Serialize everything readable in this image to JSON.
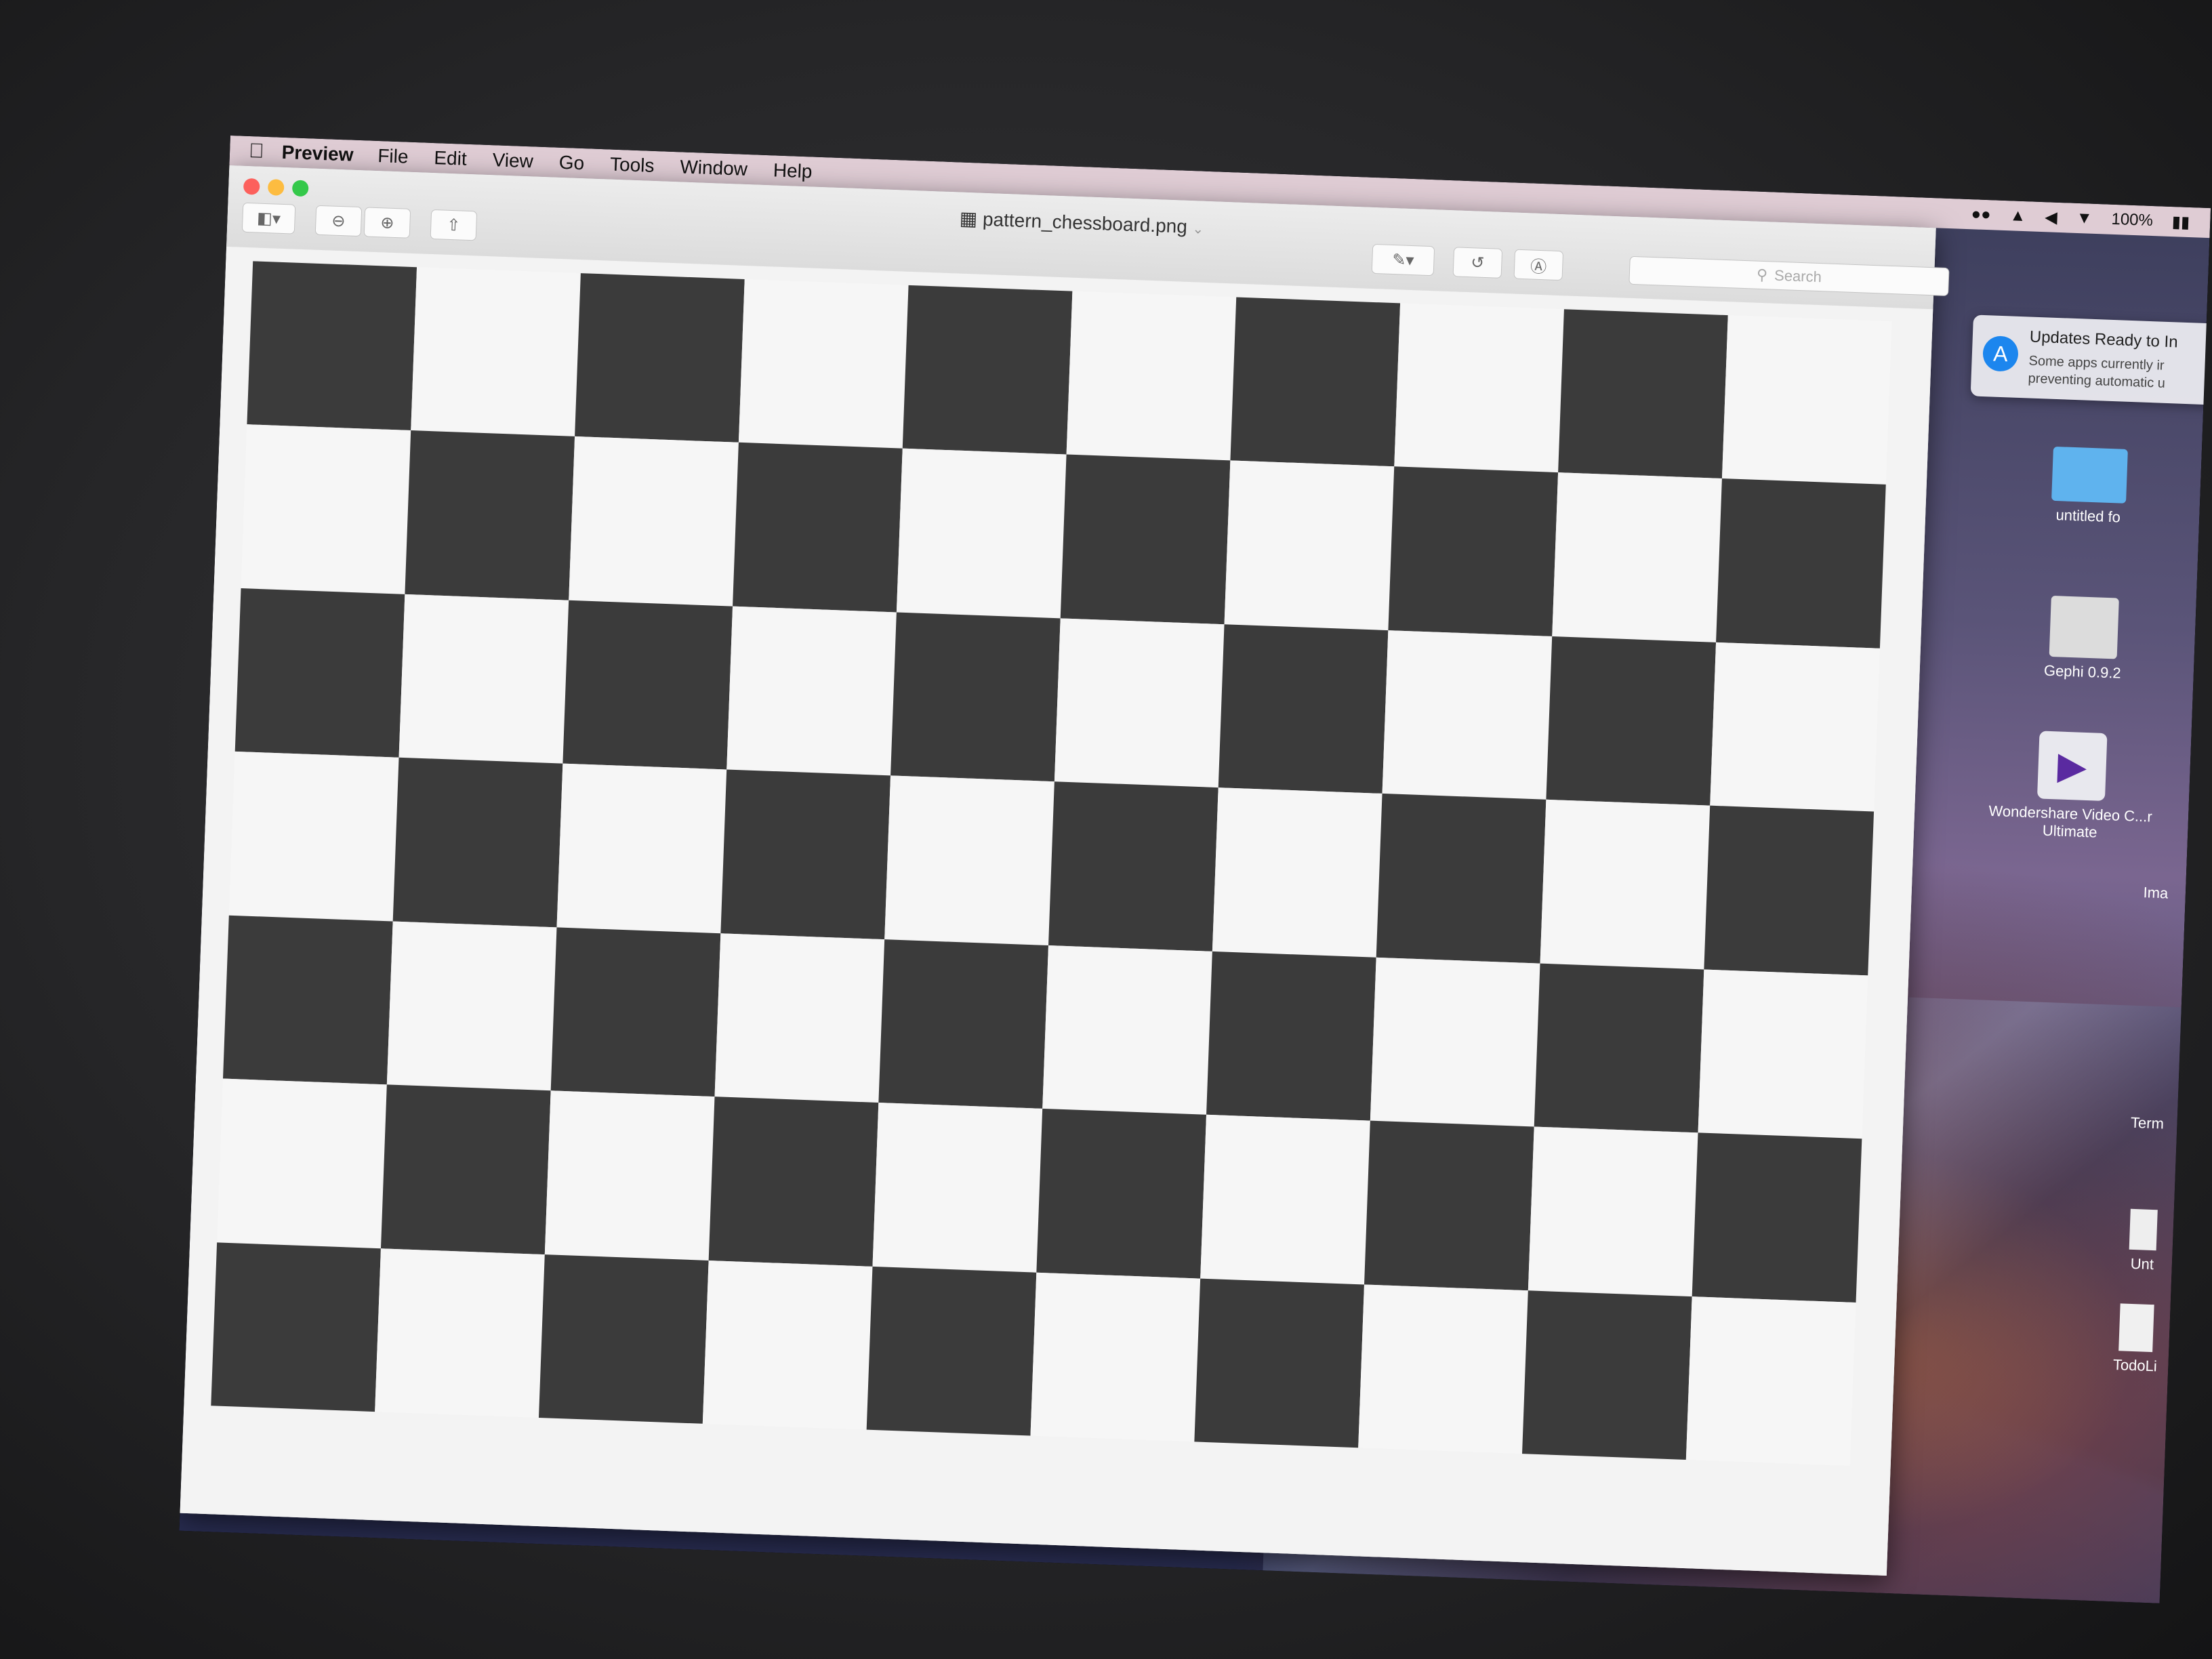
{
  "menubar": {
    "app_name": "Preview",
    "menus": [
      "File",
      "Edit",
      "View",
      "Go",
      "Tools",
      "Window",
      "Help"
    ],
    "battery": "100%"
  },
  "window": {
    "document_title": "pattern_chessboard.png",
    "search_placeholder": "Search"
  },
  "board": {
    "columns": 10,
    "rows": 7
  },
  "notification": {
    "title": "Updates Ready to In",
    "line1": "Some apps currently ir",
    "line2": "preventing automatic u"
  },
  "desktop_icons": [
    {
      "label": "untitled fo",
      "icon": "folder-icon"
    },
    {
      "label": "Gephi 0.9.2",
      "icon": "disk-image-icon"
    },
    {
      "label": "Wondershare Video C...r Ultimate",
      "icon": "app-icon"
    },
    {
      "label": "Ima",
      "icon": "file-icon"
    },
    {
      "label": "Term",
      "icon": "file-icon"
    },
    {
      "label": "Unt",
      "icon": "file-icon"
    },
    {
      "label": "TodoLi",
      "icon": "file-icon"
    }
  ],
  "colors": {
    "dark_square": "#3b3b3b",
    "light_square": "#f6f6f6",
    "close": "#fc605c",
    "minimize": "#fdbc40",
    "zoom": "#34c84a"
  }
}
